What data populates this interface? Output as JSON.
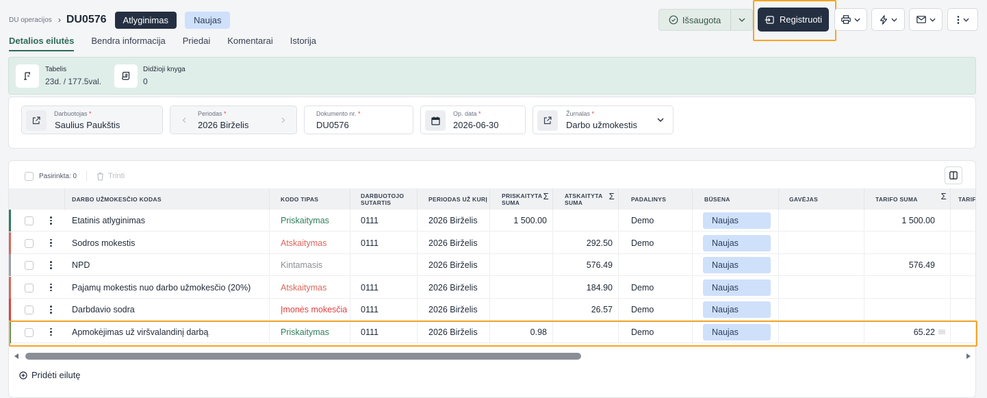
{
  "header": {
    "breadcrumb_parent": "DU operacijos",
    "breadcrumb_sep": "›",
    "doc_title": "DU0576",
    "badge_type": "Atlyginimas",
    "badge_status": "Naujas",
    "saved_label": "Išsaugota",
    "register_label": "Registruoti"
  },
  "tabs": [
    {
      "label": "Detalios eilutės",
      "active": true
    },
    {
      "label": "Bendra informacija",
      "active": false
    },
    {
      "label": "Priedai",
      "active": false
    },
    {
      "label": "Komentarai",
      "active": false
    },
    {
      "label": "Istorija",
      "active": false
    }
  ],
  "info": {
    "tabelis_label": "Tabelis",
    "tabelis_value": "23d. / 177.5val.",
    "knyga_label": "Didžioji knyga",
    "knyga_value": "0"
  },
  "form": {
    "employee_label": "Darbuotojas",
    "employee_value": "Saulius Paukštis",
    "period_label": "Periodas",
    "period_value": "2026 Birželis",
    "docnr_label": "Dokumento nr.",
    "docnr_value": "DU0576",
    "opdate_label": "Op. data",
    "opdate_value": "2026-06-30",
    "journal_label": "Žurnalas",
    "journal_value": "Darbo užmokestis",
    "required_mark": "*"
  },
  "grid": {
    "selected_label": "Pasirinkta: 0",
    "delete_label": "Trinti",
    "add_row_label": "Pridėti eilutę",
    "sigma": "Σ",
    "columns": {
      "code": "DARBO UŽMOKESČIO KODAS",
      "type": "KODO TIPAS",
      "contract": "DARBUOTOJO SUTARTIS",
      "period": "PERIODAS UŽ KURĮ",
      "accrued": "PRISKAITYTA SUMA",
      "deducted": "ATSKAITYTA SUMA",
      "unit": "PADALINYS",
      "status": "BŪSENA",
      "receiver": "GAVĖJAS",
      "rate": "TARIFO SUMA",
      "rate2": "TARIFO"
    },
    "rows": [
      {
        "code": "Etatinis atlyginimas",
        "type": "Priskaitymas",
        "contract": "0111",
        "period": "2026 Birželis",
        "accrued": "1 500.00",
        "deducted": "",
        "unit": "Demo",
        "status": "Naujas",
        "receiver": "",
        "rate": "1 500.00",
        "stripe": "#2e7d5b",
        "type_color": "#2e7d5b"
      },
      {
        "code": "Sodros mokestis",
        "type": "Atskaitymas",
        "contract": "0111",
        "period": "2026 Birželis",
        "accrued": "",
        "deducted": "292.50",
        "unit": "Demo",
        "status": "Naujas",
        "receiver": "",
        "rate": "",
        "stripe": "#d9685a",
        "type_color": "#d9685a"
      },
      {
        "code": "NPD",
        "type": "Kintamasis",
        "contract": "",
        "period": "2026 Birželis",
        "accrued": "",
        "deducted": "576.49",
        "unit": "",
        "status": "Naujas",
        "receiver": "",
        "rate": "576.49",
        "stripe": "#9aa0a6",
        "type_color": "#8a9096"
      },
      {
        "code": "Pajamų mokestis nuo darbo užmokesčio (20%)",
        "type": "Atskaitymas",
        "contract": "0111",
        "period": "2026 Birželis",
        "accrued": "",
        "deducted": "184.90",
        "unit": "Demo",
        "status": "Naujas",
        "receiver": "",
        "rate": "",
        "stripe": "#d9685a",
        "type_color": "#d9685a"
      },
      {
        "code": "Darbdavio sodra",
        "type": "Įmonės mokesčia",
        "contract": "0111",
        "period": "2026 Birželis",
        "accrued": "",
        "deducted": "26.57",
        "unit": "Demo",
        "status": "Naujas",
        "receiver": "",
        "rate": "",
        "stripe": "#e04040",
        "type_color": "#e04040"
      },
      {
        "code": "Apmokėjimas už viršvalandinį darbą",
        "type": "Priskaitymas",
        "contract": "0111",
        "period": "2026 Birželis",
        "accrued": "0.98",
        "deducted": "",
        "unit": "Demo",
        "status": "Naujas",
        "receiver": "",
        "rate": "65.22",
        "stripe": "#2e7d5b",
        "type_color": "#2e7d5b"
      }
    ]
  },
  "colors": {
    "accent_green": "#2e6a56",
    "dark_button": "#243042",
    "status_blue": "#cfe0fb",
    "highlight": "#f5a524"
  }
}
